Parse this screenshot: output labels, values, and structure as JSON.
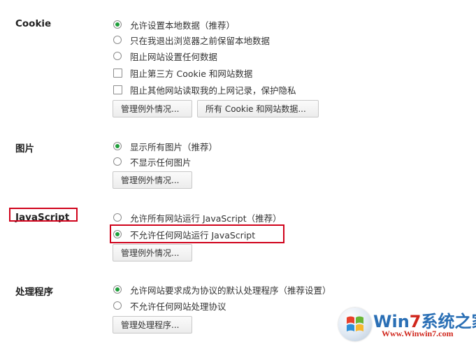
{
  "cookie": {
    "label": "Cookie",
    "options": [
      {
        "type": "radio",
        "text": "允许设置本地数据（推荐）",
        "checked": true
      },
      {
        "type": "radio",
        "text": "只在我退出浏览器之前保留本地数据",
        "checked": false
      },
      {
        "type": "radio",
        "text": "阻止网站设置任何数据",
        "checked": false
      },
      {
        "type": "checkbox",
        "text": "阻止第三方 Cookie 和网站数据",
        "checked": false
      },
      {
        "type": "checkbox",
        "text": "阻止其他网站读取我的上网记录，保护隐私",
        "checked": false
      }
    ],
    "buttons": [
      "管理例外情况...",
      "所有 Cookie 和网站数据..."
    ]
  },
  "images": {
    "label": "图片",
    "options": [
      {
        "type": "radio",
        "text": "显示所有图片（推荐）",
        "checked": true
      },
      {
        "type": "radio",
        "text": "不显示任何图片",
        "checked": false
      }
    ],
    "button": "管理例外情况..."
  },
  "javascript": {
    "label": "JavaScript",
    "options": [
      {
        "type": "radio",
        "text": "允许所有网站运行 JavaScript（推荐）",
        "checked": false
      },
      {
        "type": "radio",
        "text": "不允许任何网站运行 JavaScript",
        "checked": true
      }
    ],
    "button": "管理例外情况...",
    "highlight_color": "#d0021b"
  },
  "handlers": {
    "label": "处理程序",
    "options": [
      {
        "type": "radio",
        "text": "允许网站要求成为协议的默认处理程序（推荐设置）",
        "checked": true
      },
      {
        "type": "radio",
        "text": "不允许任何网站处理协议",
        "checked": false
      }
    ],
    "button": "管理处理程序..."
  },
  "watermark": {
    "text_prefix": "Win",
    "text_seven": "7",
    "text_suffix": "系统之家",
    "url": "Www.Winwin7.com"
  },
  "colors": {
    "radio_checked": "#1e9e3a",
    "highlight": "#d0021b"
  }
}
